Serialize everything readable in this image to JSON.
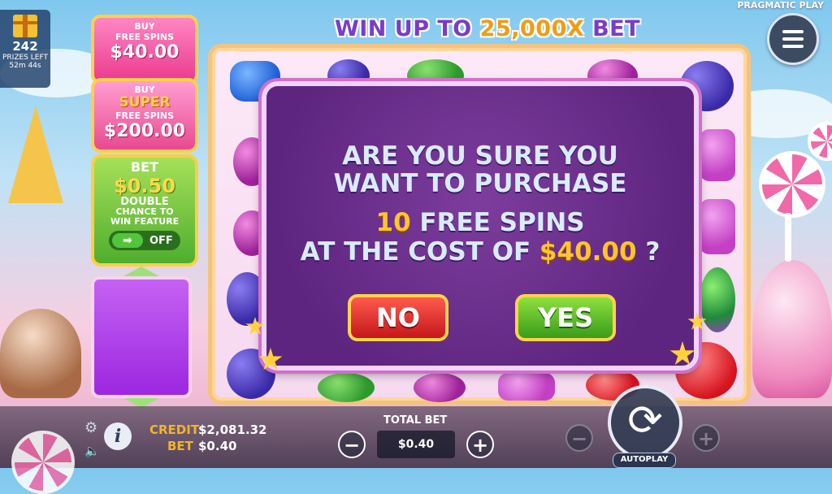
{
  "header": {
    "title_prefix": "WIN UP TO ",
    "title_highlight": "25,000X",
    "title_suffix": " BET",
    "brand": "PRAGMATIC PLAY"
  },
  "prizes": {
    "count": "242",
    "label": "PRIZES LEFT",
    "time_left": "52m 44s"
  },
  "side_panel": {
    "buy_free_spins": {
      "line1": "BUY",
      "line2": "FREE SPINS",
      "price": "$40.00"
    },
    "buy_super_free_spins": {
      "line1": "BUY",
      "super": "SUPER",
      "line2": "FREE SPINS",
      "price": "$200.00"
    },
    "ante_bet": {
      "title": "BET",
      "amount": "$0.50",
      "line1": "DOUBLE",
      "line2": "CHANCE TO",
      "line3": "WIN FEATURE",
      "toggle_arrow": "➡",
      "toggle_state": "OFF"
    }
  },
  "dialog": {
    "line1": "ARE YOU SURE YOU",
    "line2": "WANT TO PURCHASE",
    "spins_count": "10",
    "spins_text": " FREE SPINS",
    "cost_prefix": "AT THE COST OF ",
    "cost_value": "$40.00",
    "cost_suffix": " ?",
    "no_label": "NO",
    "yes_label": "YES"
  },
  "bottom_bar": {
    "credit_label": "CREDIT",
    "credit_value": "$2,081.32",
    "bet_label": "BET",
    "bet_value": "$0.40",
    "total_bet_label": "TOTAL BET",
    "total_bet_value": "$0.40",
    "minus": "−",
    "plus": "+",
    "info": "i",
    "settings_icon": "⚙",
    "sound_icon": "🔈",
    "spin_icon": "⟳",
    "autoplay_label": "AUTOPLAY"
  },
  "colors": {
    "accent_gold": "#ffc42a",
    "dialog_bg": "#5d2580",
    "no_red": "#c5161a",
    "yes_green": "#3a9c1a"
  }
}
